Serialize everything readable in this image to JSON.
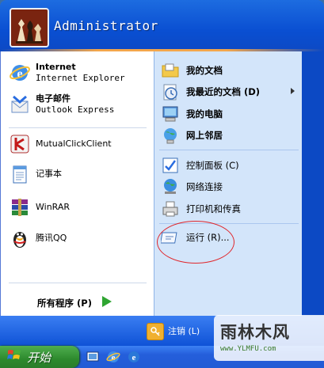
{
  "user": {
    "name": "Administrator",
    "avatar_icon": "chess-pieces-avatar"
  },
  "left_pinned": [
    {
      "title": "Internet",
      "subtitle": "Internet Explorer",
      "icon": "internet-explorer-icon"
    },
    {
      "title": "电子邮件",
      "subtitle": "Outlook Express",
      "icon": "outlook-express-icon"
    }
  ],
  "left_recent": [
    {
      "title": "MutualClickClient",
      "icon": "mutualclick-icon"
    },
    {
      "title": "记事本",
      "icon": "notepad-icon"
    },
    {
      "title": "WinRAR",
      "icon": "winrar-icon"
    },
    {
      "title": "腾讯QQ",
      "icon": "qq-penguin-icon"
    }
  ],
  "all_programs": {
    "label": "所有程序 (P)",
    "icon": "green-arrow-icon"
  },
  "right_items": [
    {
      "label": "我的文档",
      "icon": "my-documents-icon"
    },
    {
      "label": "我最近的文档 (D)",
      "icon": "recent-documents-icon",
      "has_arrow": true
    },
    {
      "label": "我的电脑",
      "icon": "my-computer-icon"
    },
    {
      "label": "网上邻居",
      "icon": "network-places-icon"
    },
    {
      "label": "控制面板 (C)",
      "icon": "control-panel-icon"
    },
    {
      "label": "网络连接",
      "icon": "network-connections-icon"
    },
    {
      "label": "打印机和传真",
      "icon": "printers-faxes-icon"
    },
    {
      "label": "运行 (R)...",
      "icon": "run-icon"
    }
  ],
  "footer": {
    "logoff_label": "注销 (L)"
  },
  "taskbar": {
    "start_label": "开始"
  },
  "watermark": {
    "title": "雨林木风",
    "url": "www.YLMFU.com"
  },
  "colors": {
    "accent_blue": "#0c49c4",
    "right_pane": "#d3e5fa",
    "start_green": "#2d8a2d",
    "highlight_ring": "#e0262b"
  }
}
